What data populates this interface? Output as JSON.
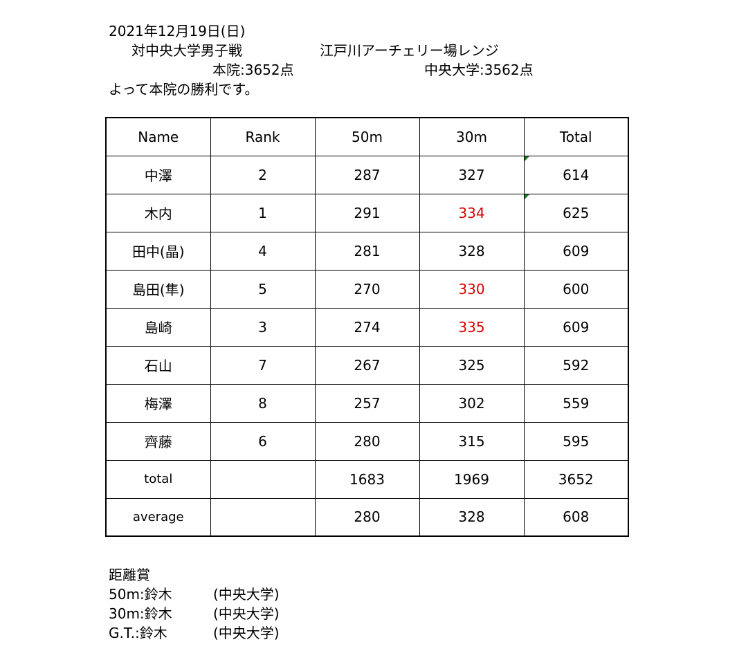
{
  "header": {
    "date": "2021年12月19日(日)",
    "match": "対中央大学男子戦",
    "venue": "江戸川アーチェリー場レンジ",
    "home_score": "本院:3652点",
    "away_score": "中央大学:3562点",
    "result": "よって本院の勝利です。"
  },
  "table": {
    "columns": [
      "Name",
      "Rank",
      "50m",
      "30m",
      "Total"
    ],
    "rows": [
      {
        "name": "中澤",
        "rank": "2",
        "m50": "287",
        "m30": "327",
        "total": "614",
        "m30_highlight": false,
        "total_note": true
      },
      {
        "name": "木内",
        "rank": "1",
        "m50": "291",
        "m30": "334",
        "total": "625",
        "m30_highlight": true,
        "total_note": true
      },
      {
        "name": "田中(晶)",
        "rank": "4",
        "m50": "281",
        "m30": "328",
        "total": "609",
        "m30_highlight": false,
        "total_note": false
      },
      {
        "name": "島田(隼)",
        "rank": "5",
        "m50": "270",
        "m30": "330",
        "total": "600",
        "m30_highlight": true,
        "total_note": false
      },
      {
        "name": "島崎",
        "rank": "3",
        "m50": "274",
        "m30": "335",
        "total": "609",
        "m30_highlight": true,
        "total_note": false
      },
      {
        "name": "石山",
        "rank": "7",
        "m50": "267",
        "m30": "325",
        "total": "592",
        "m30_highlight": false,
        "total_note": false
      },
      {
        "name": "梅澤",
        "rank": "8",
        "m50": "257",
        "m30": "302",
        "total": "559",
        "m30_highlight": false,
        "total_note": false
      },
      {
        "name": "齊藤",
        "rank": "6",
        "m50": "280",
        "m30": "315",
        "total": "595",
        "m30_highlight": false,
        "total_note": false
      }
    ],
    "summary": [
      {
        "label": "total",
        "rank": "",
        "m50": "1683",
        "m30": "1969",
        "total": "3652"
      },
      {
        "label": "average",
        "rank": "",
        "m50": "280",
        "m30": "328",
        "total": "608"
      }
    ]
  },
  "awards": {
    "title": "距離賞",
    "items": [
      {
        "distance": "50m:鈴木",
        "team": "(中央大学)"
      },
      {
        "distance": "30m:鈴木",
        "team": "(中央大学)"
      },
      {
        "distance": "G.T.:鈴木",
        "team": "(中央大学)"
      }
    ]
  },
  "colors": {
    "highlight": "#d40000",
    "note_marker": "#1f7a1f"
  }
}
